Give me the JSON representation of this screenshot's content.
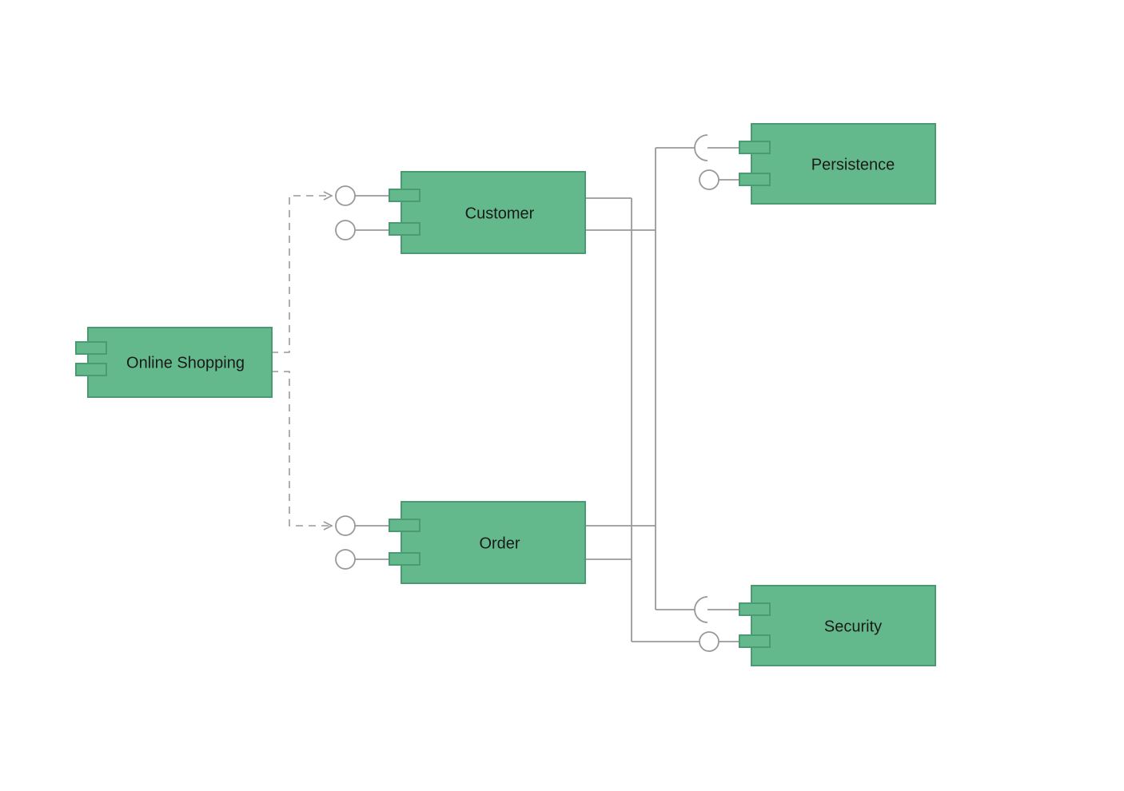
{
  "diagram": {
    "type": "UML Component Diagram",
    "components": {
      "onlineShopping": {
        "label": "Online Shopping"
      },
      "customer": {
        "label": "Customer"
      },
      "order": {
        "label": "Order"
      },
      "persistence": {
        "label": "Persistence"
      },
      "security": {
        "label": "Security"
      }
    },
    "colors": {
      "componentFill": "#63b98b",
      "componentStroke": "#4a9a72",
      "notchFill": "#63b98b",
      "notchStroke": "#4a9a72",
      "connector": "#999999"
    },
    "connections": [
      {
        "from": "onlineShopping",
        "to": "customer",
        "style": "dependency-to-required-interface"
      },
      {
        "from": "onlineShopping",
        "to": "order",
        "style": "dependency-to-required-interface"
      },
      {
        "from": "customer",
        "to": "persistence",
        "style": "assembly"
      },
      {
        "from": "customer",
        "to": "security",
        "style": "assembly"
      },
      {
        "from": "order",
        "to": "persistence",
        "style": "assembly"
      },
      {
        "from": "order",
        "to": "security",
        "style": "assembly"
      }
    ]
  }
}
